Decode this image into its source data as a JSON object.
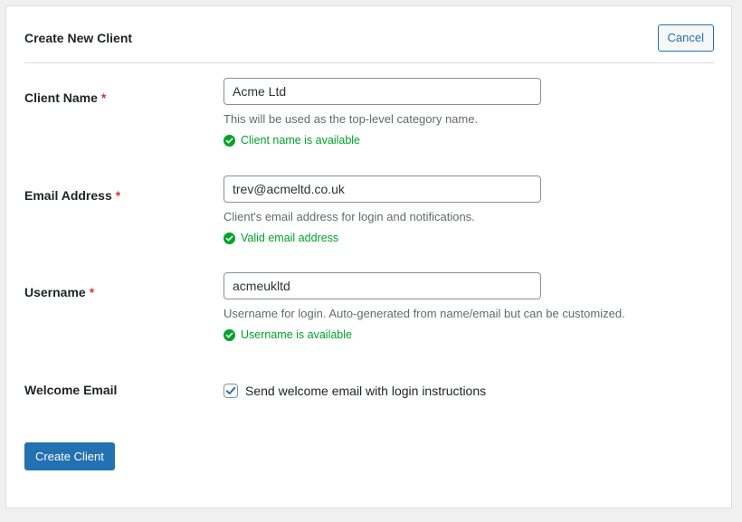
{
  "header": {
    "title": "Create New Client",
    "cancel_label": "Cancel"
  },
  "form": {
    "required_marker": "*",
    "client_name": {
      "label": "Client Name",
      "value": "Acme Ltd",
      "description": "This will be used as the top-level category name.",
      "status": "Client name is available"
    },
    "email": {
      "label": "Email Address",
      "value": "trev@acmeltd.co.uk",
      "description": "Client's email address for login and notifications.",
      "status": "Valid email address"
    },
    "username": {
      "label": "Username",
      "value": "acmeukltd",
      "description": "Username for login. Auto-generated from name/email but can be customized.",
      "status": "Username is available"
    },
    "welcome_email": {
      "label": "Welcome Email",
      "checkbox_label": "Send welcome email with login instructions",
      "checked": true
    },
    "submit_label": "Create Client"
  },
  "icons": {
    "status": "check-circle-icon",
    "checkbox": "checkmark-icon"
  },
  "colors": {
    "primary": "#2271b1",
    "success": "#00a32a",
    "required": "#d63638",
    "muted_text": "#646970"
  }
}
